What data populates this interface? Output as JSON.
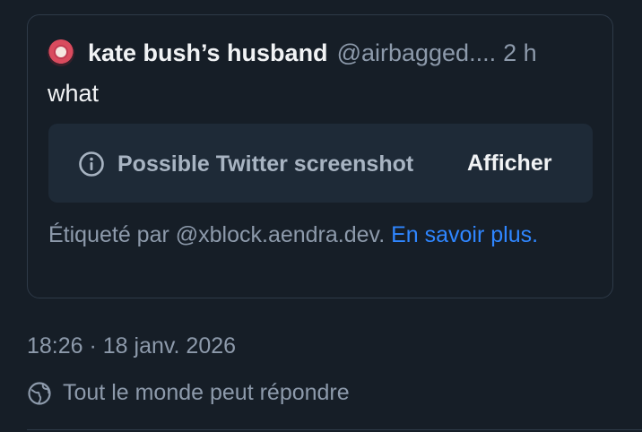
{
  "quoted_post": {
    "author_name": "kate bush’s husband",
    "author_handle": "@airbagged....",
    "time": "2 h",
    "text": "what",
    "label": {
      "icon": "info-icon",
      "text": "Possible Twitter screenshot",
      "show_label": "Afficher"
    },
    "attribution_text": "Étiqueté par @xblock.aendra.dev. ",
    "learn_more_label": "En savoir plus."
  },
  "post_meta": {
    "timestamp": "18:26 · 18 janv. 2026",
    "reply_setting": "Tout le monde peut répondre",
    "reply_icon": "globe-icon"
  },
  "colors": {
    "background": "#161e27",
    "card_border": "#2e3a48",
    "label_bg": "#1e2a37",
    "link": "#2f86ff",
    "muted": "#8d9aab"
  }
}
